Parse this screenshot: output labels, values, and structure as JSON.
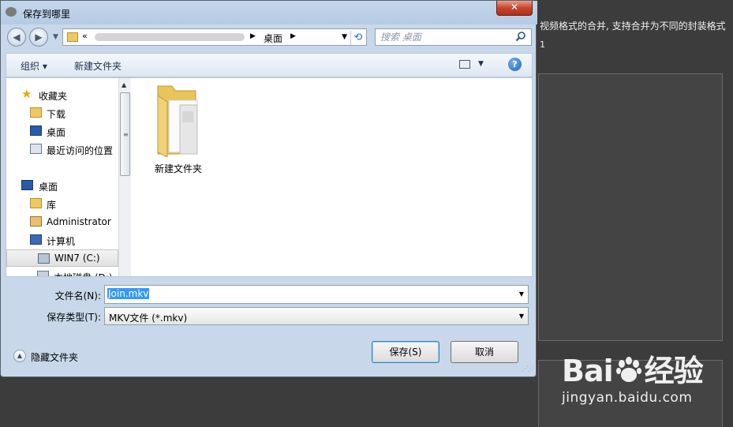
{
  "background": {
    "text_line1": "视频格式的合并, 支持合并为不同的封装格式",
    "text_line2": "1"
  },
  "watermark": {
    "logo_prefix": "Bai",
    "logo_suffix": "经验",
    "url": "jingyan.baidu.com",
    "paw_icon": "baidu-paw-icon"
  },
  "dialog": {
    "title": "保存到哪里",
    "close_glyph": "✕",
    "nav": {
      "back_glyph": "◀",
      "forward_glyph": "▶",
      "address_prefix": "«",
      "address_segment": "桌面",
      "search_placeholder": "搜索 桌面"
    },
    "toolbar": {
      "organize": "组织 ▾",
      "new_folder": "新建文件夹",
      "help_glyph": "?"
    },
    "nav_pane": [
      {
        "label": "收藏夹",
        "icon": "star-icon"
      },
      {
        "label": "下载",
        "icon": "download-folder-icon"
      },
      {
        "label": "桌面",
        "icon": "desktop-icon"
      },
      {
        "label": "最近访问的位置",
        "icon": "recent-places-icon"
      },
      {
        "label": "桌面",
        "icon": "desktop-icon"
      },
      {
        "label": "库",
        "icon": "library-icon"
      },
      {
        "label": "Administrator",
        "icon": "user-folder-icon"
      },
      {
        "label": "计算机",
        "icon": "computer-icon"
      },
      {
        "label": "WIN7 (C:)",
        "icon": "drive-icon"
      },
      {
        "label": "本地磁盘 (D:)",
        "icon": "drive-icon"
      }
    ],
    "files": [
      {
        "label": "新建文件夹",
        "icon": "folder-icon"
      }
    ],
    "filename_label": "文件名(N):",
    "filename_value": "Join.mkv",
    "filetype_label": "保存类型(T):",
    "filetype_value": "MKV文件 (*.mkv)",
    "hide_folders": "隐藏文件夹",
    "save_button": "保存(S)",
    "cancel_button": "取消"
  }
}
